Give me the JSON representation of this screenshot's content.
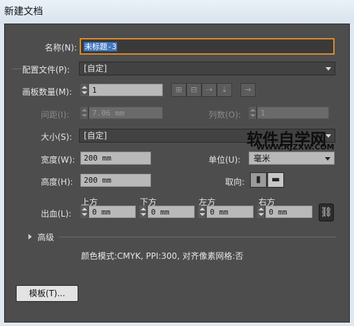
{
  "window": {
    "title": "新建文档"
  },
  "form": {
    "name_label": "名称(N):",
    "name_value": "未标题-3",
    "profile_label": "配置文件(P):",
    "profile_value": "[自定]",
    "artboards_label": "画板数量(M):",
    "artboards_value": "1",
    "spacing_label": "间距(I):",
    "spacing_value": "7.06 mm",
    "columns_label": "列数(O):",
    "columns_value": "1",
    "size_label": "大小(S):",
    "size_value": "[自定]",
    "width_label": "宽度(W):",
    "width_value": "200 mm",
    "units_label": "单位(U):",
    "units_value": "毫米",
    "height_label": "高度(H):",
    "height_value": "200 mm",
    "orientation_label": "取向:",
    "bleed_label": "出血(L):",
    "bleed": {
      "top_label": "上方",
      "top_value": "0 mm",
      "bottom_label": "下方",
      "bottom_value": "0 mm",
      "left_label": "左方",
      "left_value": "0 mm",
      "right_label": "右方",
      "right_value": "0 mm"
    },
    "advanced_label": "高级",
    "summary": "颜色模式:CMYK, PPI:300, 对齐像素网格:否"
  },
  "buttons": {
    "templates_label": "模板(T)..."
  },
  "watermark": {
    "title": "软件自学网",
    "url": "WWW.RJZXW.COM"
  },
  "icons": [
    "spinner-icon",
    "grid-by-row-icon",
    "grid-by-column-icon",
    "arrange-by-row-icon",
    "arrange-by-column-icon",
    "right-to-left-icon",
    "portrait-icon",
    "landscape-icon",
    "link-icon",
    "expand-triangle-icon",
    "dropdown-caret-icon"
  ],
  "colors": {
    "panel": "#4d4d4d",
    "selection": "#3e78c0",
    "focus_border": "#d98a2c"
  }
}
